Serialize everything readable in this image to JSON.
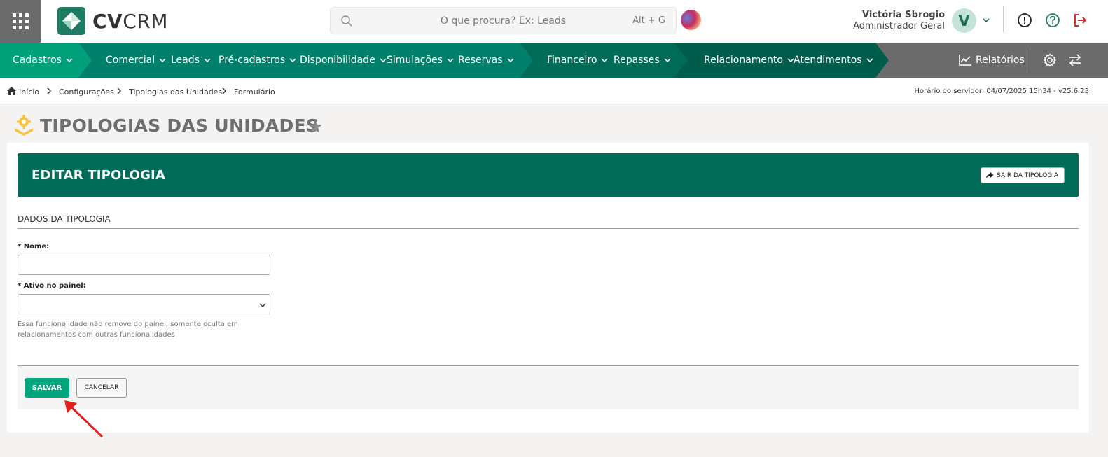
{
  "app": {
    "logo_text_bold": "CV",
    "logo_text_light": "CRM"
  },
  "search": {
    "placeholder": "O que procura? Ex: Leads",
    "shortcut": "Alt + G"
  },
  "user": {
    "name": "Victória Sbrogio",
    "role": "Administrador Geral",
    "avatar_initial": "V"
  },
  "nav": {
    "items": [
      {
        "label": "Cadastros"
      },
      {
        "label": "Comercial"
      },
      {
        "label": "Leads"
      },
      {
        "label": "Pré-cadastros"
      },
      {
        "label": "Disponibilidade"
      },
      {
        "label": "Simulações"
      },
      {
        "label": "Reservas"
      },
      {
        "label": "Financeiro"
      },
      {
        "label": "Repasses"
      },
      {
        "label": "Relacionamento"
      },
      {
        "label": "Atendimentos"
      }
    ],
    "reports_label": "Relatórios",
    "colors": {
      "teal_light": "#00a07a",
      "teal_mid": "#00806a",
      "teal_dark": "#006c58",
      "gray": "#6b6b6b"
    }
  },
  "breadcrumb": {
    "items": [
      "Início",
      "Configurações",
      "Tipologias das Unidades",
      "Formulário"
    ],
    "server_time": "Horário do servidor: 04/07/2025 15h34 - v25.6.23"
  },
  "page": {
    "title": "TIPOLOGIAS DAS UNIDADES"
  },
  "card": {
    "title": "EDITAR TIPOLOGIA",
    "exit_label": "SAIR DA TIPOLOGIA",
    "section_title": "DADOS DA TIPOLOGIA",
    "fields": {
      "nome_label": "* Nome:",
      "nome_value": "",
      "ativo_label": "* Ativo no painel:",
      "ativo_value": "",
      "ativo_help": "Essa funcionalidade não remove do painel, somente oculta em relacionamentos com outras funcionalidades"
    },
    "save_label": "SALVAR",
    "cancel_label": "CANCELAR"
  },
  "colors": {
    "brand_green": "#006c58",
    "save_green": "#00a67e",
    "logout_red": "#d32f2f",
    "help_green": "#1e7b5f",
    "annotation_red": "#e0201b"
  }
}
